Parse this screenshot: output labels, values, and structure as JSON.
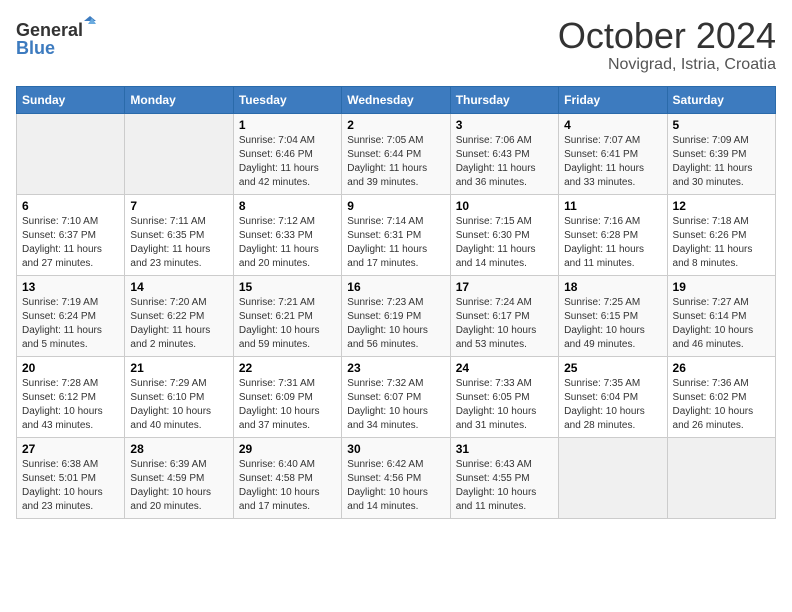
{
  "header": {
    "logo_line1": "General",
    "logo_line2": "Blue",
    "month": "October 2024",
    "location": "Novigrad, Istria, Croatia"
  },
  "days_of_week": [
    "Sunday",
    "Monday",
    "Tuesday",
    "Wednesday",
    "Thursday",
    "Friday",
    "Saturday"
  ],
  "weeks": [
    [
      {
        "day": "",
        "info": ""
      },
      {
        "day": "",
        "info": ""
      },
      {
        "day": "1",
        "info": "Sunrise: 7:04 AM\nSunset: 6:46 PM\nDaylight: 11 hours and 42 minutes."
      },
      {
        "day": "2",
        "info": "Sunrise: 7:05 AM\nSunset: 6:44 PM\nDaylight: 11 hours and 39 minutes."
      },
      {
        "day": "3",
        "info": "Sunrise: 7:06 AM\nSunset: 6:43 PM\nDaylight: 11 hours and 36 minutes."
      },
      {
        "day": "4",
        "info": "Sunrise: 7:07 AM\nSunset: 6:41 PM\nDaylight: 11 hours and 33 minutes."
      },
      {
        "day": "5",
        "info": "Sunrise: 7:09 AM\nSunset: 6:39 PM\nDaylight: 11 hours and 30 minutes."
      }
    ],
    [
      {
        "day": "6",
        "info": "Sunrise: 7:10 AM\nSunset: 6:37 PM\nDaylight: 11 hours and 27 minutes."
      },
      {
        "day": "7",
        "info": "Sunrise: 7:11 AM\nSunset: 6:35 PM\nDaylight: 11 hours and 23 minutes."
      },
      {
        "day": "8",
        "info": "Sunrise: 7:12 AM\nSunset: 6:33 PM\nDaylight: 11 hours and 20 minutes."
      },
      {
        "day": "9",
        "info": "Sunrise: 7:14 AM\nSunset: 6:31 PM\nDaylight: 11 hours and 17 minutes."
      },
      {
        "day": "10",
        "info": "Sunrise: 7:15 AM\nSunset: 6:30 PM\nDaylight: 11 hours and 14 minutes."
      },
      {
        "day": "11",
        "info": "Sunrise: 7:16 AM\nSunset: 6:28 PM\nDaylight: 11 hours and 11 minutes."
      },
      {
        "day": "12",
        "info": "Sunrise: 7:18 AM\nSunset: 6:26 PM\nDaylight: 11 hours and 8 minutes."
      }
    ],
    [
      {
        "day": "13",
        "info": "Sunrise: 7:19 AM\nSunset: 6:24 PM\nDaylight: 11 hours and 5 minutes."
      },
      {
        "day": "14",
        "info": "Sunrise: 7:20 AM\nSunset: 6:22 PM\nDaylight: 11 hours and 2 minutes."
      },
      {
        "day": "15",
        "info": "Sunrise: 7:21 AM\nSunset: 6:21 PM\nDaylight: 10 hours and 59 minutes."
      },
      {
        "day": "16",
        "info": "Sunrise: 7:23 AM\nSunset: 6:19 PM\nDaylight: 10 hours and 56 minutes."
      },
      {
        "day": "17",
        "info": "Sunrise: 7:24 AM\nSunset: 6:17 PM\nDaylight: 10 hours and 53 minutes."
      },
      {
        "day": "18",
        "info": "Sunrise: 7:25 AM\nSunset: 6:15 PM\nDaylight: 10 hours and 49 minutes."
      },
      {
        "day": "19",
        "info": "Sunrise: 7:27 AM\nSunset: 6:14 PM\nDaylight: 10 hours and 46 minutes."
      }
    ],
    [
      {
        "day": "20",
        "info": "Sunrise: 7:28 AM\nSunset: 6:12 PM\nDaylight: 10 hours and 43 minutes."
      },
      {
        "day": "21",
        "info": "Sunrise: 7:29 AM\nSunset: 6:10 PM\nDaylight: 10 hours and 40 minutes."
      },
      {
        "day": "22",
        "info": "Sunrise: 7:31 AM\nSunset: 6:09 PM\nDaylight: 10 hours and 37 minutes."
      },
      {
        "day": "23",
        "info": "Sunrise: 7:32 AM\nSunset: 6:07 PM\nDaylight: 10 hours and 34 minutes."
      },
      {
        "day": "24",
        "info": "Sunrise: 7:33 AM\nSunset: 6:05 PM\nDaylight: 10 hours and 31 minutes."
      },
      {
        "day": "25",
        "info": "Sunrise: 7:35 AM\nSunset: 6:04 PM\nDaylight: 10 hours and 28 minutes."
      },
      {
        "day": "26",
        "info": "Sunrise: 7:36 AM\nSunset: 6:02 PM\nDaylight: 10 hours and 26 minutes."
      }
    ],
    [
      {
        "day": "27",
        "info": "Sunrise: 6:38 AM\nSunset: 5:01 PM\nDaylight: 10 hours and 23 minutes."
      },
      {
        "day": "28",
        "info": "Sunrise: 6:39 AM\nSunset: 4:59 PM\nDaylight: 10 hours and 20 minutes."
      },
      {
        "day": "29",
        "info": "Sunrise: 6:40 AM\nSunset: 4:58 PM\nDaylight: 10 hours and 17 minutes."
      },
      {
        "day": "30",
        "info": "Sunrise: 6:42 AM\nSunset: 4:56 PM\nDaylight: 10 hours and 14 minutes."
      },
      {
        "day": "31",
        "info": "Sunrise: 6:43 AM\nSunset: 4:55 PM\nDaylight: 10 hours and 11 minutes."
      },
      {
        "day": "",
        "info": ""
      },
      {
        "day": "",
        "info": ""
      }
    ]
  ]
}
